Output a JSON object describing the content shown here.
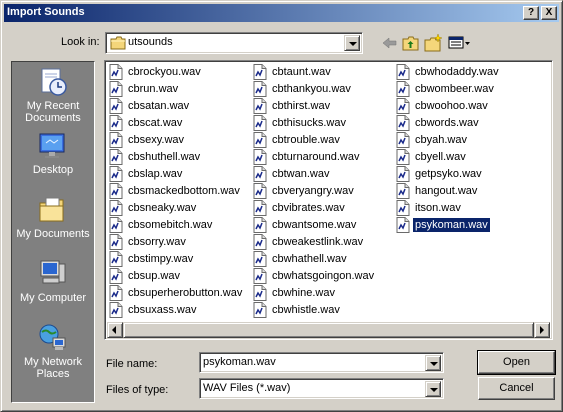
{
  "window": {
    "title": "Import Sounds",
    "help_button": "?",
    "close_button": "X"
  },
  "lookin": {
    "label": "Look in:",
    "accesskey": "i",
    "value": "utsounds"
  },
  "places": [
    {
      "label": "My Recent Documents",
      "icon": "recent-documents-icon"
    },
    {
      "label": "Desktop",
      "icon": "desktop-icon"
    },
    {
      "label": "My Documents",
      "icon": "my-documents-icon"
    },
    {
      "label": "My Computer",
      "icon": "my-computer-icon"
    },
    {
      "label": "My Network Places",
      "icon": "network-places-icon"
    }
  ],
  "files": {
    "col1": [
      "cbrockyou.wav",
      "cbrun.wav",
      "cbsatan.wav",
      "cbscat.wav",
      "cbsexy.wav",
      "cbshuthell.wav",
      "cbslap.wav",
      "cbsmackedbottom.wav",
      "cbsneaky.wav",
      "cbsomebitch.wav",
      "cbsorry.wav",
      "cbstimpy.wav",
      "cbsup.wav",
      "cbsuperherobutton.wav",
      "cbsuxass.wav"
    ],
    "col2": [
      "cbtaunt.wav",
      "cbthankyou.wav",
      "cbthirst.wav",
      "cbthisucks.wav",
      "cbtrouble.wav",
      "cbturnaround.wav",
      "cbtwan.wav",
      "cbveryangry.wav",
      "cbvibrates.wav",
      "cbwantsome.wav",
      "cbweakestlink.wav",
      "cbwhathell.wav",
      "cbwhatsgoingon.wav",
      "cbwhine.wav",
      "cbwhistle.wav"
    ],
    "col3": [
      "cbwhodaddy.wav",
      "cbwombeer.wav",
      "cbwoohoo.wav",
      "cbwords.wav",
      "cbyah.wav",
      "cbyell.wav",
      "getpsyko.wav",
      "hangout.wav",
      "itson.wav",
      "psykoman.wav"
    ],
    "selected": "psykoman.wav"
  },
  "filename": {
    "label": "File name:",
    "value": "psykoman.wav"
  },
  "filetype": {
    "label": "Files of type:",
    "value": "WAV Files (*.wav)"
  },
  "buttons": {
    "open": "Open",
    "cancel": "Cancel"
  },
  "colors": {
    "title_start": "#0a246a",
    "title_end": "#a6caf0",
    "selection": "#0a246a",
    "face": "#d4d0c8"
  }
}
